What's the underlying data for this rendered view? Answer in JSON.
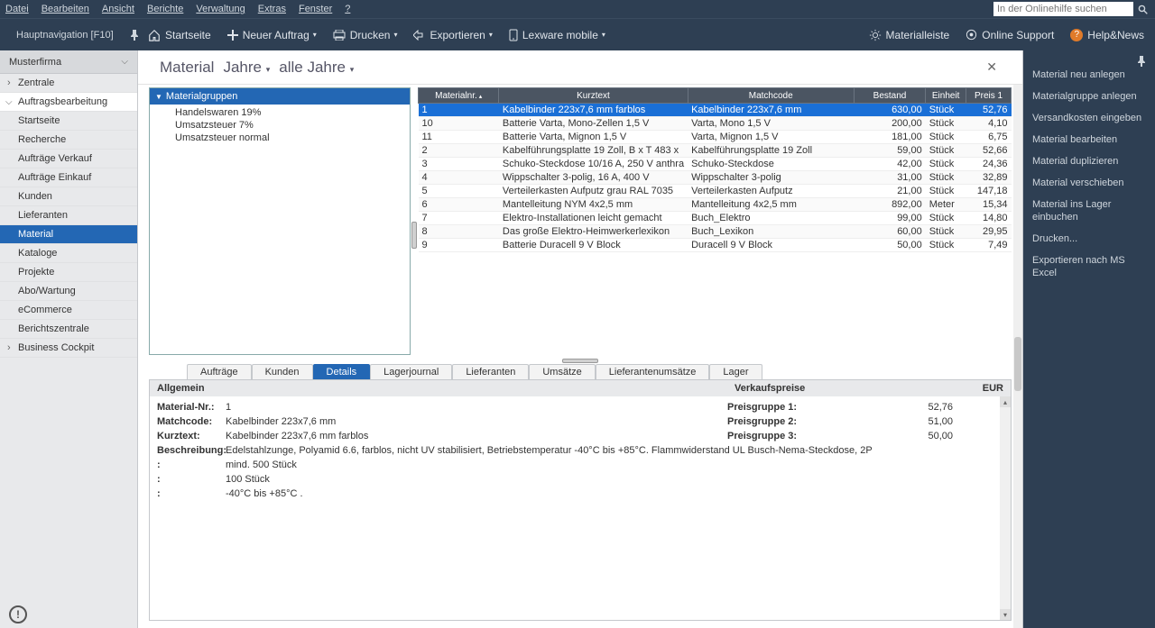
{
  "menubar": {
    "items": [
      "Datei",
      "Bearbeiten",
      "Ansicht",
      "Berichte",
      "Verwaltung",
      "Extras",
      "Fenster",
      "?"
    ],
    "search_placeholder": "In der Onlinehilfe suchen"
  },
  "toolbar": {
    "nav_label": "Hauptnavigation [F10]",
    "home": "Startseite",
    "new_order": "Neuer Auftrag",
    "print": "Drucken",
    "export": "Exportieren",
    "lexware": "Lexware mobile",
    "material_bar": "Materialleiste",
    "online_support": "Online Support",
    "help_news": "Help&News"
  },
  "leftnav": {
    "header": "Musterfirma",
    "items": [
      {
        "label": "Zentrale",
        "has_children": true
      },
      {
        "label": "Auftragsbearbeitung",
        "has_children": true,
        "active": true
      },
      {
        "label": "Startseite"
      },
      {
        "label": "Recherche"
      },
      {
        "label": "Aufträge Verkauf"
      },
      {
        "label": "Aufträge Einkauf"
      },
      {
        "label": "Kunden"
      },
      {
        "label": "Lieferanten"
      },
      {
        "label": "Material",
        "highlight": true
      },
      {
        "label": "Kataloge"
      },
      {
        "label": "Projekte"
      },
      {
        "label": "Abo/Wartung"
      },
      {
        "label": "eCommerce"
      },
      {
        "label": "Berichtszentrale"
      },
      {
        "label": "Business Cockpit",
        "has_children": true
      }
    ]
  },
  "page": {
    "title_main": "Material",
    "title_years_label": "Jahre",
    "title_years_value": "alle Jahre"
  },
  "tree": {
    "root": "Materialgruppen",
    "children": [
      "Handelswaren 19%",
      "Umsatzsteuer 7%",
      "Umsatzsteuer normal"
    ]
  },
  "grid": {
    "columns": [
      "Materialnr.",
      "Kurztext",
      "Matchcode",
      "Bestand",
      "Einheit",
      "Preis 1"
    ],
    "rows": [
      {
        "nr": "1",
        "kurz": "Kabelbinder 223x7,6 mm farblos",
        "match": "Kabelbinder 223x7,6 mm",
        "best": "630,00",
        "ein": "Stück",
        "preis": "52,76",
        "sel": true
      },
      {
        "nr": "10",
        "kurz": "Batterie Varta, Mono-Zellen 1,5 V",
        "match": "Varta, Mono 1,5 V",
        "best": "200,00",
        "ein": "Stück",
        "preis": "4,10"
      },
      {
        "nr": "11",
        "kurz": "Batterie Varta, Mignon 1,5 V",
        "match": "Varta, Mignon 1,5 V",
        "best": "181,00",
        "ein": "Stück",
        "preis": "6,75"
      },
      {
        "nr": "2",
        "kurz": "Kabelführungsplatte 19 Zoll,  B x T 483 x",
        "match": "Kabelführungsplatte 19 Zoll",
        "best": "59,00",
        "ein": "Stück",
        "preis": "52,66"
      },
      {
        "nr": "3",
        "kurz": "Schuko-Steckdose 10/16 A, 250 V anthra",
        "match": "Schuko-Steckdose",
        "best": "42,00",
        "ein": "Stück",
        "preis": "24,36"
      },
      {
        "nr": "4",
        "kurz": "Wippschalter 3-polig, 16 A, 400 V",
        "match": "Wippschalter 3-polig",
        "best": "31,00",
        "ein": "Stück",
        "preis": "32,89"
      },
      {
        "nr": "5",
        "kurz": "Verteilerkasten Aufputz grau RAL 7035",
        "match": "Verteilerkasten Aufputz",
        "best": "21,00",
        "ein": "Stück",
        "preis": "147,18"
      },
      {
        "nr": "6",
        "kurz": "Mantelleitung NYM 4x2,5 mm",
        "match": "Mantelleitung 4x2,5 mm",
        "best": "892,00",
        "ein": "Meter",
        "preis": "15,34"
      },
      {
        "nr": "7",
        "kurz": "Elektro-Installationen leicht gemacht",
        "match": "Buch_Elektro",
        "best": "99,00",
        "ein": "Stück",
        "preis": "14,80"
      },
      {
        "nr": "8",
        "kurz": "Das große Elektro-Heimwerkerlexikon",
        "match": "Buch_Lexikon",
        "best": "60,00",
        "ein": "Stück",
        "preis": "29,95"
      },
      {
        "nr": "9",
        "kurz": "Batterie Duracell 9 V Block",
        "match": "Duracell 9 V Block",
        "best": "50,00",
        "ein": "Stück",
        "preis": "7,49"
      }
    ]
  },
  "detail_tabs": [
    "Aufträge",
    "Kunden",
    "Details",
    "Lagerjournal",
    "Lieferanten",
    "Umsätze",
    "Lieferantenumsätze",
    "Lager"
  ],
  "detail_active_tab": "Details",
  "detail": {
    "section_general": "Allgemein",
    "section_prices": "Verkaufspreise",
    "currency": "EUR",
    "material_nr_label": "Material-Nr.:",
    "material_nr": "1",
    "matchcode_label": "Matchcode:",
    "matchcode": "Kabelbinder 223x7,6 mm",
    "kurztext_label": "Kurztext:",
    "kurztext": "Kabelbinder 223x7,6 mm farblos",
    "beschr_label": "Beschreibung:",
    "beschr": "Edelstahlzunge, Polyamid 6.6, farblos, nicht UV stabilisiert, Betriebstemperatur -40°C bis +85°C. Flammwiderstand UL Busch-Nema-Steckdose, 2P",
    "line2": "mind. 500 Stück",
    "line3": "100 Stück",
    "line4": "-40°C bis +85°C .",
    "price1_label": "Preisgruppe 1:",
    "price1": "52,76",
    "price2_label": "Preisgruppe 2:",
    "price2": "51,00",
    "price3_label": "Preisgruppe 3:",
    "price3": "50,00"
  },
  "rightpanel": {
    "actions": [
      "Material neu anlegen",
      "Materialgruppe anlegen",
      "Versandkosten eingeben",
      "Material bearbeiten",
      "Material duplizieren",
      "Material verschieben",
      "Material ins Lager einbuchen",
      "Drucken...",
      "Exportieren nach MS Excel"
    ]
  }
}
